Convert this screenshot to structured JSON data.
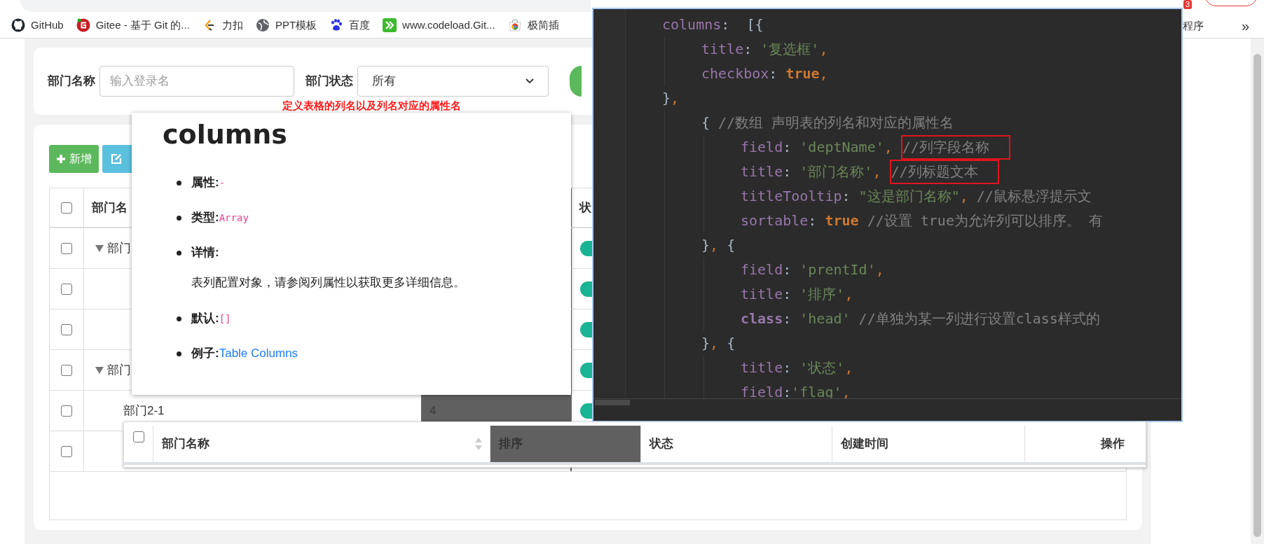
{
  "browser": {
    "notification_badge": "3",
    "bookmarks": [
      {
        "label": "GitHub"
      },
      {
        "label": "Gitee - 基于 Git 的..."
      },
      {
        "label": "力扣"
      },
      {
        "label": "PPT模板"
      },
      {
        "label": "百度"
      },
      {
        "label": "www.codeload.Git..."
      },
      {
        "label": "极简插"
      }
    ],
    "bookmark_partial": "程序",
    "overflow": "»"
  },
  "search_form": {
    "fields": [
      {
        "kind": "input",
        "label": "部门名称",
        "placeholder": "输入登录名"
      },
      {
        "kind": "select",
        "label": "部门状态",
        "value": "所有"
      }
    ]
  },
  "annotation": "定义表格的列名以及列名对应的属性名",
  "toolbar": [
    {
      "kind": "add",
      "label": "新增"
    },
    {
      "kind": "edit"
    }
  ],
  "table": {
    "header": {
      "checked": false,
      "columns": [
        "部门名",
        "",
        "状"
      ]
    },
    "rows": [
      {
        "checked": false,
        "name": "部门",
        "expanded": true,
        "badge": true,
        "children": [
          {
            "checked": false,
            "badge": true
          },
          {
            "checked": false,
            "badge": true
          }
        ]
      },
      {
        "checked": false,
        "name": "部门",
        "expanded": true,
        "badge": true,
        "children": [
          {
            "checked": false,
            "name": "部门2-1",
            "sort": "4",
            "badge": true
          },
          {
            "checked": false,
            "badge": false
          }
        ]
      }
    ]
  },
  "doc_popup": {
    "title": "columns",
    "items": [
      {
        "label": "属性:",
        "value": "-",
        "kind": "code"
      },
      {
        "label": "类型:",
        "value": "Array",
        "kind": "code"
      },
      {
        "label": "详情:",
        "description": "表列配置对象，请参阅列属性以获取更多详细信息。"
      },
      {
        "label": "默认:",
        "value": "[]",
        "kind": "code"
      },
      {
        "label": "例子:",
        "value": "Table Columns",
        "kind": "link"
      }
    ]
  },
  "code_editor": {
    "lines": [
      {
        "tokens": [
          {
            "kind": "key",
            "text": "columns"
          },
          {
            "kind": "punct",
            "text": ":  [{"
          }
        ],
        "children": [
          {
            "tokens": [
              {
                "kind": "key",
                "text": "title"
              },
              {
                "kind": "punct",
                "text": ": "
              },
              {
                "kind": "str",
                "text": "'复选框'"
              },
              {
                "kind": "comma",
                "text": ","
              }
            ]
          },
          {
            "tokens": [
              {
                "kind": "key",
                "text": "checkbox"
              },
              {
                "kind": "punct",
                "text": ": "
              },
              {
                "kind": "kw",
                "text": "true"
              },
              {
                "kind": "comma",
                "text": ","
              }
            ]
          }
        ]
      },
      {
        "tokens": [
          {
            "kind": "punct",
            "text": "}"
          },
          {
            "kind": "comma",
            "text": ","
          }
        ],
        "children": [
          {
            "tokens": [
              {
                "kind": "punct",
                "text": "{ "
              },
              {
                "kind": "comment",
                "text": "//数组 声明表的列名和对应的属性名"
              }
            ],
            "children": [
              {
                "tokens": [
                  {
                    "kind": "key",
                    "text": "field"
                  },
                  {
                    "kind": "punct",
                    "text": ": "
                  },
                  {
                    "kind": "str",
                    "text": "'deptName'"
                  },
                  {
                    "kind": "comma",
                    "text": ", "
                  },
                  {
                    "kind": "boxed_comment",
                    "text": "//列字段名称"
                  }
                ]
              },
              {
                "tokens": [
                  {
                    "kind": "key",
                    "text": "title"
                  },
                  {
                    "kind": "punct",
                    "text": ": "
                  },
                  {
                    "kind": "str",
                    "text": "'部门名称'"
                  },
                  {
                    "kind": "comma",
                    "text": ", "
                  },
                  {
                    "kind": "boxed_comment",
                    "text": "//列标题文本"
                  }
                ]
              },
              {
                "tokens": [
                  {
                    "kind": "key",
                    "text": "titleTooltip"
                  },
                  {
                    "kind": "punct",
                    "text": ": "
                  },
                  {
                    "kind": "str",
                    "text": "\"这是部门名称\""
                  },
                  {
                    "kind": "comma",
                    "text": ", "
                  },
                  {
                    "kind": "comment",
                    "text": "//鼠标悬浮提示文"
                  }
                ]
              },
              {
                "tokens": [
                  {
                    "kind": "key",
                    "text": "sortable"
                  },
                  {
                    "kind": "punct",
                    "text": ": "
                  },
                  {
                    "kind": "kw",
                    "text": "true"
                  },
                  {
                    "kind": "comment",
                    "text": " //设置 true为允许列可以排序。 有"
                  }
                ]
              }
            ]
          },
          {
            "tokens": [
              {
                "kind": "punct",
                "text": "}"
              },
              {
                "kind": "comma",
                "text": ", "
              },
              {
                "kind": "punct",
                "text": "{"
              }
            ],
            "children": [
              {
                "tokens": [
                  {
                    "kind": "key",
                    "text": "field"
                  },
                  {
                    "kind": "punct",
                    "text": ": "
                  },
                  {
                    "kind": "str",
                    "text": "'prentId'"
                  },
                  {
                    "kind": "comma",
                    "text": ","
                  }
                ]
              },
              {
                "tokens": [
                  {
                    "kind": "key",
                    "text": "title"
                  },
                  {
                    "kind": "punct",
                    "text": ": "
                  },
                  {
                    "kind": "str",
                    "text": "'排序'"
                  },
                  {
                    "kind": "comma",
                    "text": ","
                  }
                ]
              },
              {
                "tokens": [
                  {
                    "kind": "kw_key",
                    "text": "class"
                  },
                  {
                    "kind": "punct",
                    "text": ": "
                  },
                  {
                    "kind": "str",
                    "text": "'head'"
                  },
                  {
                    "kind": "comment",
                    "text": " //单独为某一列进行设置class样式的"
                  }
                ]
              }
            ]
          },
          {
            "tokens": [
              {
                "kind": "punct",
                "text": "}"
              },
              {
                "kind": "comma",
                "text": ", "
              },
              {
                "kind": "punct",
                "text": "{"
              }
            ],
            "children": [
              {
                "tokens": [
                  {
                    "kind": "key",
                    "text": "title"
                  },
                  {
                    "kind": "punct",
                    "text": ": "
                  },
                  {
                    "kind": "str",
                    "text": "'状态'"
                  },
                  {
                    "kind": "comma",
                    "text": ","
                  }
                ]
              },
              {
                "tokens": [
                  {
                    "kind": "key",
                    "text": "field"
                  },
                  {
                    "kind": "punct",
                    "text": ":"
                  },
                  {
                    "kind": "str",
                    "text": "'flag'"
                  },
                  {
                    "kind": "comma",
                    "text": ","
                  }
                ]
              }
            ]
          }
        ]
      }
    ]
  },
  "floating_header": {
    "checked": false,
    "columns": [
      {
        "label": "部门名称",
        "sortable": true,
        "highlighted": false
      },
      {
        "label": "排序",
        "sortable": false,
        "highlighted": true
      },
      {
        "label": "状态",
        "sortable": false,
        "highlighted": false
      },
      {
        "label": "创建时间",
        "sortable": false,
        "highlighted": false
      },
      {
        "label": "操作",
        "sortable": false,
        "highlighted": false
      }
    ]
  }
}
